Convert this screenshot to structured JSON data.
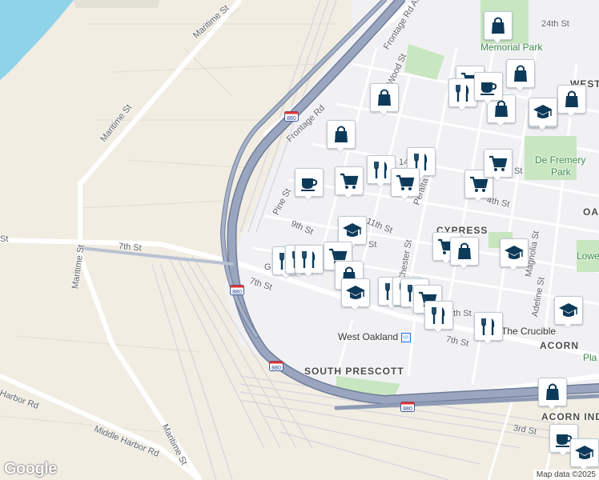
{
  "map": {
    "colors": {
      "water": "#8fd3e8",
      "land_industrial": "#f1ede3",
      "land_urban": "#f1f1f4",
      "park": "#c8e6c0",
      "highway": "#8e9bb4",
      "highway_edge": "#6f7d99",
      "street": "#ffffff",
      "rail": "#d2d0d5",
      "marker_icon": "#0e3a5a"
    },
    "labels": [
      {
        "id": "maritime-st-top",
        "text": "Maritime St"
      },
      {
        "id": "maritime-st-left",
        "text": "Maritime St"
      },
      {
        "id": "maritime-st-mid",
        "text": "Maritime St"
      },
      {
        "id": "maritime-st-bottom",
        "text": "Maritime St"
      },
      {
        "id": "frontage-rd",
        "text": "Frontage Rd"
      },
      {
        "id": "frontage-rd-ave",
        "text": "Frontage Rd Ave"
      },
      {
        "id": "7th-st-left",
        "text": "7th St"
      },
      {
        "id": "7th-st-mid",
        "text": "7th St"
      },
      {
        "id": "7th-st-right",
        "text": "7th St"
      },
      {
        "id": "harbor-rd",
        "text": "Harbor Rd"
      },
      {
        "id": "middle-harbor-rd",
        "text": "Middle Harbor Rd"
      },
      {
        "id": "st-left-edge",
        "text": "St"
      },
      {
        "id": "24th-st",
        "text": "24th St"
      },
      {
        "id": "memorial-park",
        "text": "Memorial Park"
      },
      {
        "id": "wood-st",
        "text": "Wood St"
      },
      {
        "id": "pine-st",
        "text": "Pine St"
      },
      {
        "id": "9th-st",
        "text": "9th St"
      },
      {
        "id": "11th-st",
        "text": "11th St"
      },
      {
        "id": "peralta-st",
        "text": "Peralta St"
      },
      {
        "id": "chester-st",
        "text": "Chester St"
      },
      {
        "id": "cypress-1",
        "text": "CYPRESS"
      },
      {
        "id": "de-fremery",
        "text": "De Fremery"
      },
      {
        "id": "park",
        "text": "Park"
      },
      {
        "id": "west",
        "text": "WEST"
      },
      {
        "id": "magnolia-st",
        "text": "Magnolia St"
      },
      {
        "id": "adeline-st",
        "text": "Adeline St"
      },
      {
        "id": "west-oakland",
        "text": "West Oakland"
      },
      {
        "id": "south-prescott",
        "text": "SOUTH PRESCOTT"
      },
      {
        "id": "the-crucible",
        "text": "The Crucible"
      },
      {
        "id": "acorn",
        "text": "ACORN"
      },
      {
        "id": "acorn-industrial",
        "text": "ACORN INDUSTRIAL"
      },
      {
        "id": "3rd-st",
        "text": "3rd St"
      },
      {
        "id": "oa",
        "text": "OA"
      },
      {
        "id": "lowe",
        "text": "Lowe"
      },
      {
        "id": "pla",
        "text": "Pla"
      },
      {
        "id": "4th-st",
        "text": "4th St"
      },
      {
        "id": "st-5",
        "text": "St"
      },
      {
        "id": "8th-st",
        "text": "8th St"
      },
      {
        "id": "14th",
        "text": "14"
      },
      {
        "id": "st-near-cypress",
        "text": "St"
      },
      {
        "id": "g-fragment",
        "text": "G"
      }
    ],
    "highway_shields": [
      {
        "id": "880-top",
        "text": "880"
      },
      {
        "id": "880-mid",
        "text": "880"
      },
      {
        "id": "880-lower",
        "text": "880"
      },
      {
        "id": "880-bottom",
        "text": "880"
      }
    ],
    "markers": [
      {
        "type": "shopping-bag"
      },
      {
        "type": "shopping-cart"
      },
      {
        "type": "restaurant"
      },
      {
        "type": "shopping-bag"
      },
      {
        "type": "shopping-bag"
      },
      {
        "type": "coffee"
      },
      {
        "type": "restaurant"
      },
      {
        "type": "shopping-bag"
      },
      {
        "type": "school"
      },
      {
        "type": "shopping-bag"
      },
      {
        "type": "shopping-bag"
      },
      {
        "type": "coffee"
      },
      {
        "type": "shopping-cart"
      },
      {
        "type": "restaurant"
      },
      {
        "type": "restaurant"
      },
      {
        "type": "shopping-cart"
      },
      {
        "type": "shopping-cart"
      },
      {
        "type": "shopping-cart"
      },
      {
        "type": "school"
      },
      {
        "type": "shopping-cart"
      },
      {
        "type": "shopping-bag"
      },
      {
        "type": "school"
      },
      {
        "type": "restaurant"
      },
      {
        "type": "restaurant"
      },
      {
        "type": "restaurant"
      },
      {
        "type": "shopping-cart"
      },
      {
        "type": "shopping-bag"
      },
      {
        "type": "school"
      },
      {
        "type": "restaurant"
      },
      {
        "type": "restaurant"
      },
      {
        "type": "restaurant"
      },
      {
        "type": "shopping-cart"
      },
      {
        "type": "restaurant"
      },
      {
        "type": "restaurant"
      },
      {
        "type": "school"
      },
      {
        "type": "shopping-bag"
      },
      {
        "type": "coffee"
      },
      {
        "type": "school"
      }
    ]
  },
  "logo": {
    "text": "Google"
  },
  "attribution": {
    "text": "Map data ©2025"
  }
}
